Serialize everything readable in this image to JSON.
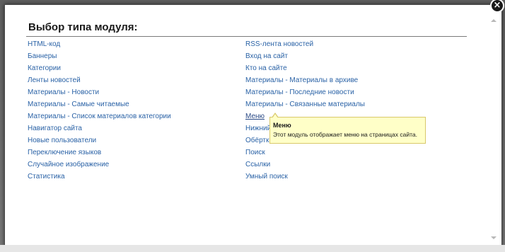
{
  "dialog": {
    "title": "Выбор типа модуля:",
    "close_symbol": "×"
  },
  "modules_left": [
    "HTML-код",
    "Баннеры",
    "Категории",
    "Ленты новостей",
    "Материалы - Новости",
    "Материалы - Самые читаемые",
    "Материалы - Список материалов категории",
    "Навигатор сайта",
    "Новые пользователи",
    "Переключение языков",
    "Случайное изображение",
    "Статистика"
  ],
  "modules_right": [
    "RSS-лента новостей",
    "Вход на сайт",
    "Кто на сайте",
    "Материалы - Материалы в архиве",
    "Материалы - Последние новости",
    "Материалы - Связанные материалы",
    "Меню",
    "Нижний",
    "Обёртк",
    "Поиск",
    "Ссылки",
    "Умный поиск"
  ],
  "hovered_module": "Меню",
  "tooltip": {
    "title": "Меню",
    "description": "Этот модуль отображает меню на страницах сайта."
  },
  "colors": {
    "link": "#2a62a6",
    "tooltip_bg": "#ffffc8",
    "tooltip_border": "#d8c86a"
  }
}
